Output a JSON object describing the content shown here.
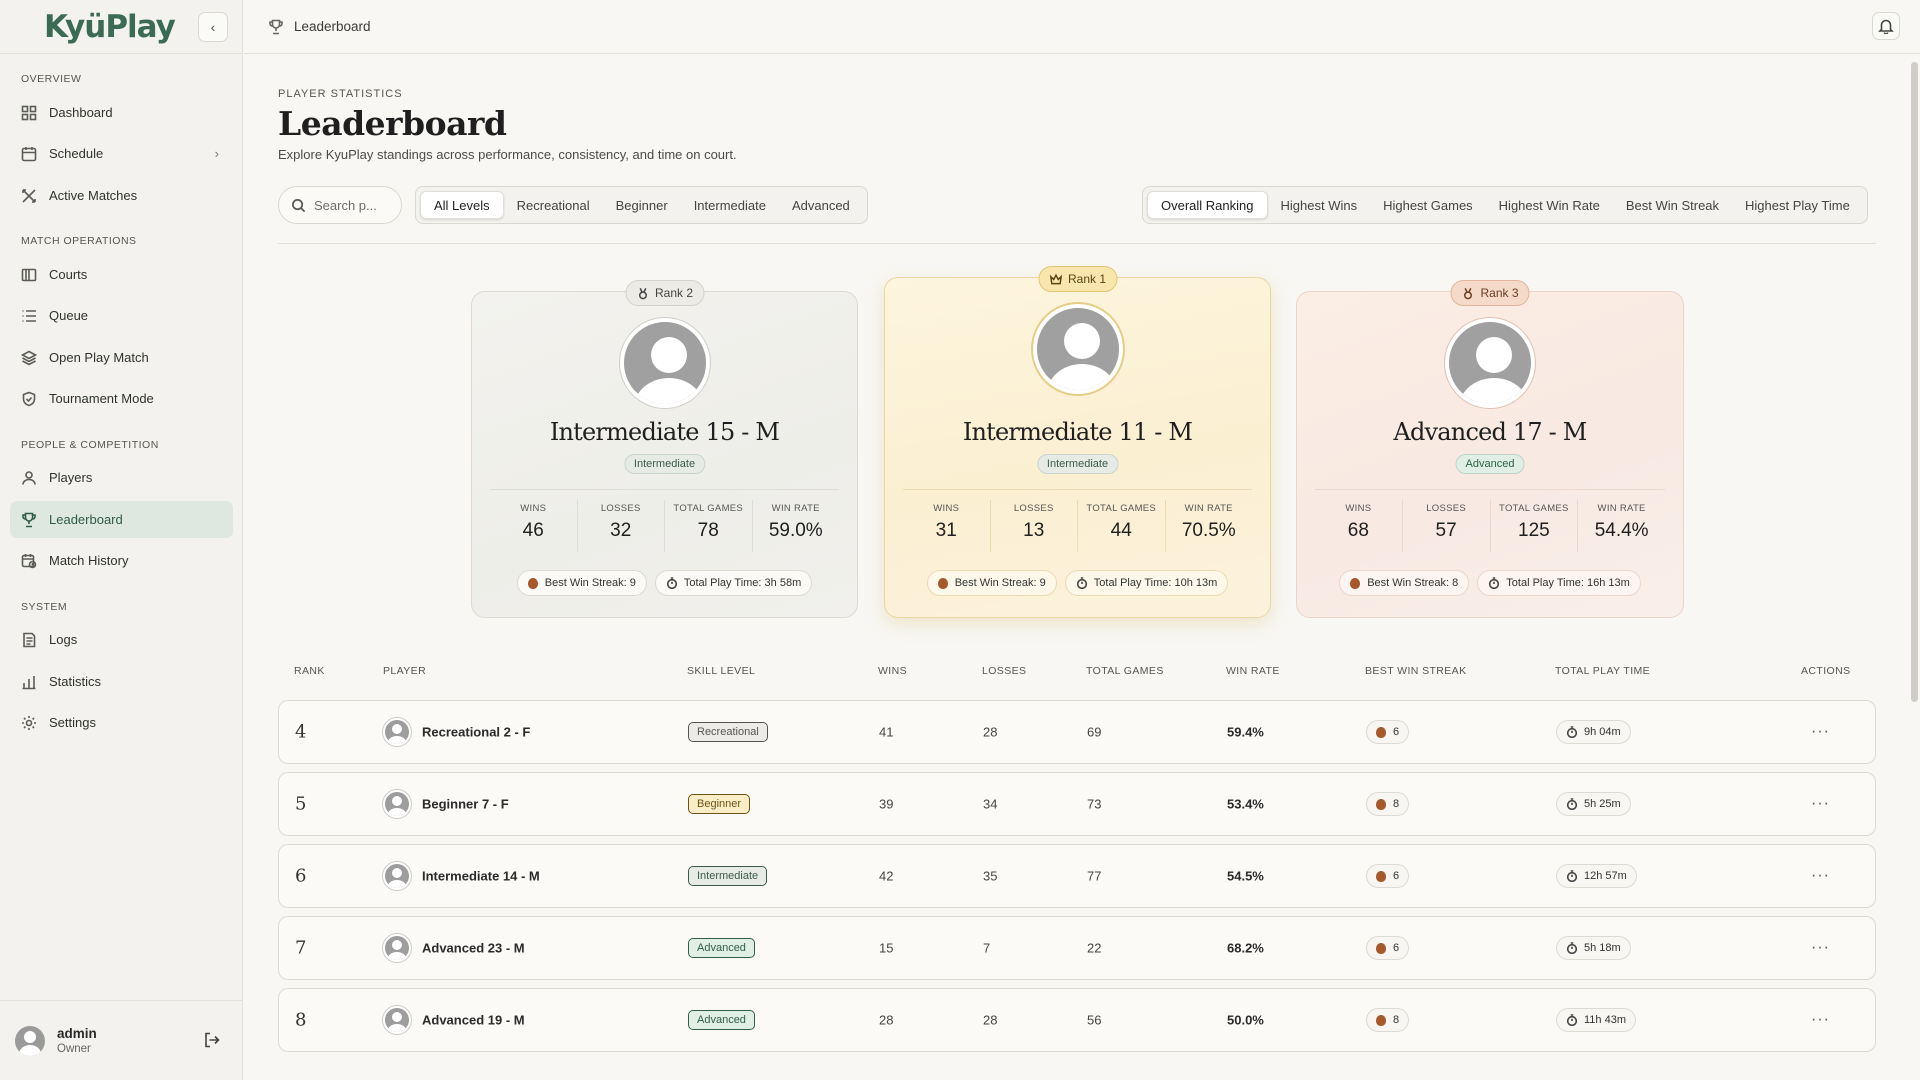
{
  "app": {
    "logo": "KyüPlay"
  },
  "topbar": {
    "breadcrumb": "Leaderboard"
  },
  "sidebar": {
    "sections": {
      "overview": "OVERVIEW",
      "match_ops": "MATCH OPERATIONS",
      "people": "PEOPLE & COMPETITION",
      "system": "SYSTEM"
    },
    "items": [
      {
        "label": "Dashboard"
      },
      {
        "label": "Schedule"
      },
      {
        "label": "Active Matches"
      },
      {
        "label": "Courts"
      },
      {
        "label": "Queue"
      },
      {
        "label": "Open Play Match"
      },
      {
        "label": "Tournament Mode"
      },
      {
        "label": "Players"
      },
      {
        "label": "Leaderboard"
      },
      {
        "label": "Match History"
      },
      {
        "label": "Logs"
      },
      {
        "label": "Statistics"
      },
      {
        "label": "Settings"
      }
    ],
    "user": {
      "name": "admin",
      "role": "Owner"
    }
  },
  "header": {
    "eyebrow": "PLAYER STATISTICS",
    "title": "Leaderboard",
    "subtitle": "Explore KyuPlay standings across performance, consistency, and time on court."
  },
  "search": {
    "placeholder": "Search p..."
  },
  "level_filters": [
    "All Levels",
    "Recreational",
    "Beginner",
    "Intermediate",
    "Advanced"
  ],
  "sort_options": [
    "Overall Ranking",
    "Highest Wins",
    "Highest Games",
    "Highest Win Rate",
    "Best Win Streak",
    "Highest Play Time"
  ],
  "podium": {
    "stat_labels": {
      "wins": "WINS",
      "losses": "LOSSES",
      "total_games": "TOTAL GAMES",
      "win_rate": "WIN RATE"
    },
    "first": {
      "rank_label": "Rank 1",
      "name": "Intermediate 11 - M",
      "level": "Intermediate",
      "wins": "31",
      "losses": "13",
      "total_games": "44",
      "win_rate": "70.5%",
      "streak": "Best Win Streak: 9",
      "play_time": "Total Play Time: 10h 13m"
    },
    "second": {
      "rank_label": "Rank 2",
      "name": "Intermediate 15 - M",
      "level": "Intermediate",
      "wins": "46",
      "losses": "32",
      "total_games": "78",
      "win_rate": "59.0%",
      "streak": "Best Win Streak: 9",
      "play_time": "Total Play Time: 3h 58m"
    },
    "third": {
      "rank_label": "Rank 3",
      "name": "Advanced 17 - M",
      "level": "Advanced",
      "wins": "68",
      "losses": "57",
      "total_games": "125",
      "win_rate": "54.4%",
      "streak": "Best Win Streak: 8",
      "play_time": "Total Play Time: 16h 13m"
    }
  },
  "table": {
    "headers": {
      "rank": "RANK",
      "player": "PLAYER",
      "skill": "SKILL LEVEL",
      "wins": "WINS",
      "losses": "LOSSES",
      "total_games": "TOTAL GAMES",
      "win_rate": "WIN RATE",
      "streak": "BEST WIN STREAK",
      "play_time": "TOTAL PLAY TIME",
      "actions": "ACTIONS"
    },
    "rows": [
      {
        "rank": "4",
        "name": "Recreational 2 - F",
        "level": "Recreational",
        "wins": "41",
        "losses": "28",
        "total_games": "69",
        "win_rate": "59.4%",
        "streak": "6",
        "time": "9h 04m",
        "actions": "···"
      },
      {
        "rank": "5",
        "name": "Beginner 7 - F",
        "level": "Beginner",
        "wins": "39",
        "losses": "34",
        "total_games": "73",
        "win_rate": "53.4%",
        "streak": "8",
        "time": "5h 25m",
        "actions": "···"
      },
      {
        "rank": "6",
        "name": "Intermediate 14 - M",
        "level": "Intermediate",
        "wins": "42",
        "losses": "35",
        "total_games": "77",
        "win_rate": "54.5%",
        "streak": "6",
        "time": "12h 57m",
        "actions": "···"
      },
      {
        "rank": "7",
        "name": "Advanced 23 - M",
        "level": "Advanced",
        "wins": "15",
        "losses": "7",
        "total_games": "22",
        "win_rate": "68.2%",
        "streak": "6",
        "time": "5h 18m",
        "actions": "···"
      },
      {
        "rank": "8",
        "name": "Advanced 19 - M",
        "level": "Advanced",
        "wins": "28",
        "losses": "28",
        "total_games": "56",
        "win_rate": "50.0%",
        "streak": "8",
        "time": "11h 43m",
        "actions": "···"
      }
    ]
  },
  "colors": {
    "accent": "#2f5d46",
    "gold": "#f9e6ad",
    "bronze": "#f5d9c9",
    "ball": "#a7582a"
  }
}
